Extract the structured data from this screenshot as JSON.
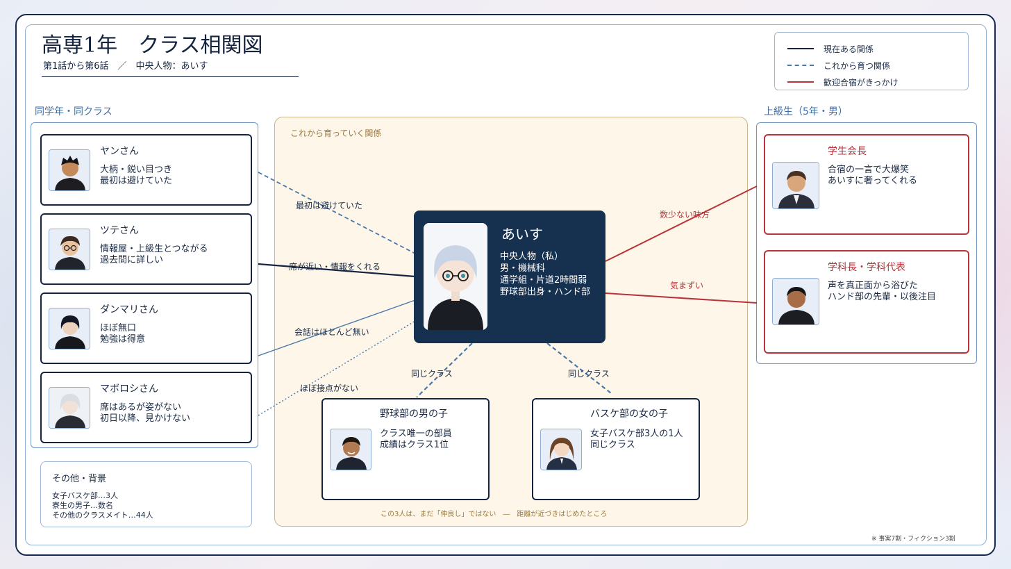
{
  "header": {
    "title": "高専1年　クラス相関図",
    "subtitle": "第1話から第6話　／　中央人物：あいす"
  },
  "legend": [
    {
      "label": "現在ある関係",
      "style": "solid",
      "color": "#14233f"
    },
    {
      "label": "これから育つ関係",
      "style": "dashed",
      "color": "#4a78aa"
    },
    {
      "label": "歓迎合宿がきっかけ",
      "style": "solid",
      "color": "#b8333a"
    }
  ],
  "sections": {
    "left": "同学年・同クラス",
    "right": "上級生（5年・男）",
    "growing": "これから育っていく関係",
    "growing_footer": "この3人は、まだ「仲良し」ではない　―　距離が近づきはじめたところ"
  },
  "center": {
    "name": "あいす",
    "lines": [
      "中央人物（私）",
      "男・機械科",
      "通学組・片道2時間弱",
      "野球部出身・ハンド部"
    ]
  },
  "classmates": [
    {
      "name": "ヤンさん",
      "lines": [
        "大柄・鋭い目つき",
        "最初は避けていた"
      ],
      "edge_label": "最初は避けていた",
      "icon": "student-avatar-icon"
    },
    {
      "name": "ツテさん",
      "lines": [
        "情報屋・上級生とつながる",
        "過去問に詳しい"
      ],
      "edge_label": "席が近い・情報をくれる",
      "icon": "student-glasses-avatar-icon"
    },
    {
      "name": "ダンマリさん",
      "lines": [
        "ほぼ無口",
        "勉強は得意"
      ],
      "edge_label": "会話はほとんど無い",
      "icon": "student-avatar-icon"
    },
    {
      "name": "マボロシさん",
      "lines": [
        "席はあるが姿がない",
        "初日以降、見かけない"
      ],
      "edge_label": "ほぼ接点がない",
      "icon": "student-avatar-icon"
    }
  ],
  "seniors": [
    {
      "name": "学生会長",
      "lines": [
        "合宿の一言で大爆笑",
        "あいすに奢ってくれる"
      ],
      "edge_label": "数少ない味方",
      "icon": "senior-avatar-icon"
    },
    {
      "name": "学科長・学科代表",
      "lines": [
        "声を真正面から浴びた",
        "ハンド部の先輩・以後注目"
      ],
      "edge_label": "気まずい",
      "icon": "senior-avatar-icon"
    }
  ],
  "growing": [
    {
      "name": "野球部の男の子",
      "lines": [
        "クラス唯一の部員",
        "成績はクラス1位"
      ],
      "edge_label": "同じクラス",
      "icon": "boy-avatar-icon"
    },
    {
      "name": "バスケ部の女の子",
      "lines": [
        "女子バスケ部3人の1人",
        "同じクラス"
      ],
      "edge_label": "同じクラス",
      "icon": "girl-avatar-icon"
    }
  ],
  "other": {
    "title": "その他・背景",
    "items": [
      "女子バスケ部…3人",
      "寮生の男子…数名",
      "その他のクラスメイト…44人"
    ]
  },
  "footnote": "※ 事実7割・フィクション3割"
}
